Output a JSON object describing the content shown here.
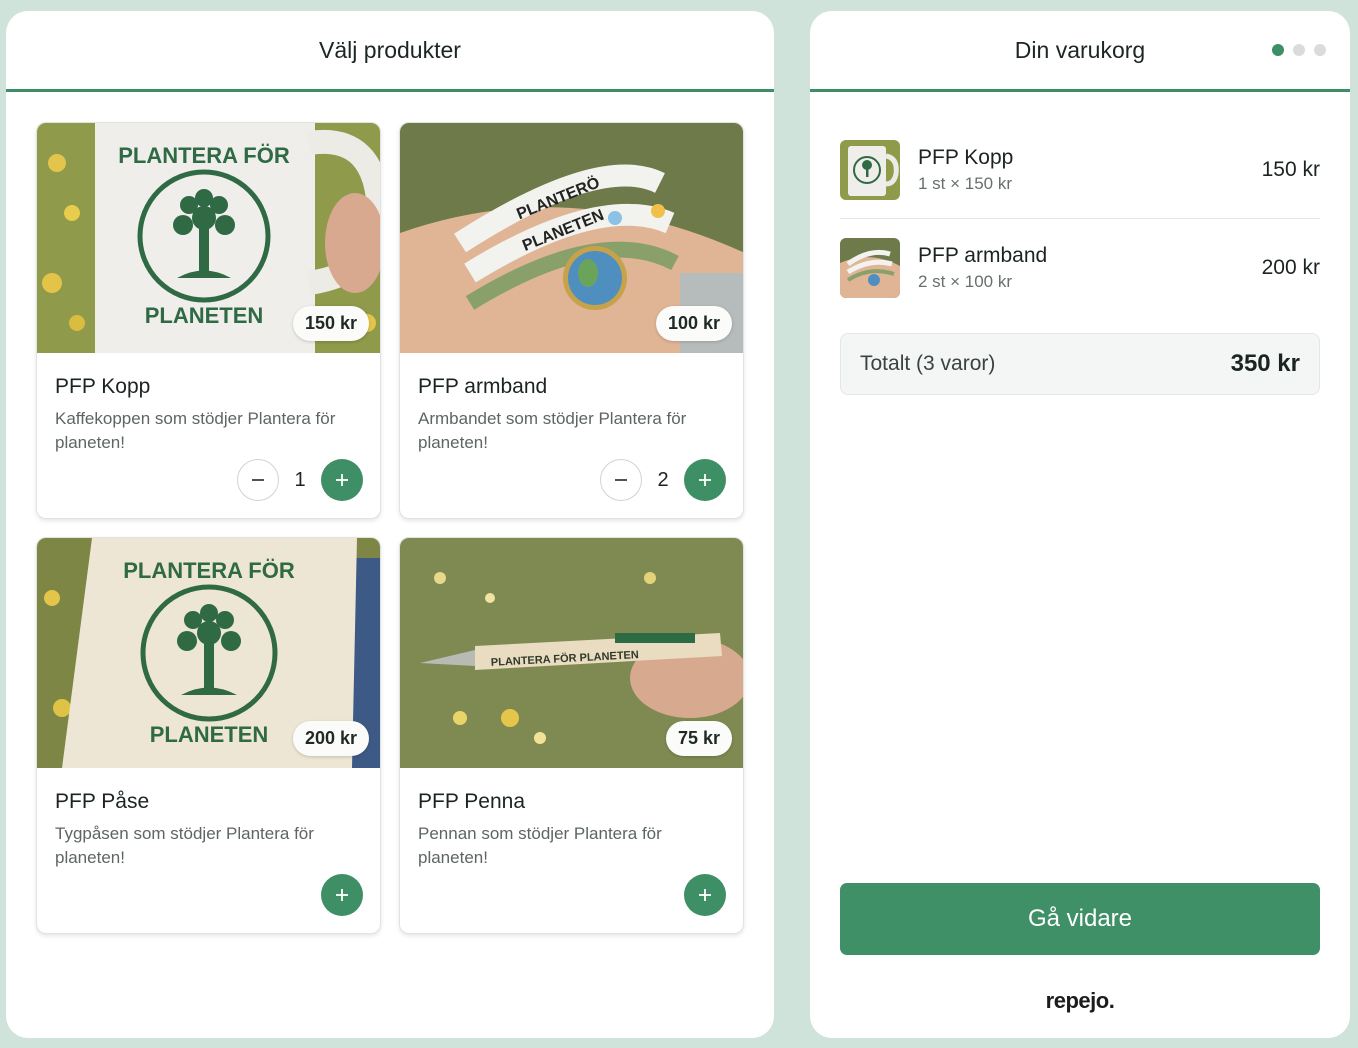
{
  "products_panel": {
    "title": "Välj produkter",
    "products": [
      {
        "name": "PFP Kopp",
        "description": "Kaffekoppen som stödjer Plantera för planeten!",
        "price": "150 kr",
        "quantity": "1"
      },
      {
        "name": "PFP armband",
        "description": "Armbandet som stödjer Plantera för planeten!",
        "price": "100 kr",
        "quantity": "2"
      },
      {
        "name": "PFP Påse",
        "description": "Tygpåsen som stödjer Plantera för planeten!",
        "price": "200 kr",
        "quantity": "0"
      },
      {
        "name": "PFP Penna",
        "description": "Pennan som stödjer Plantera för planeten!",
        "price": "75 kr",
        "quantity": "0"
      }
    ],
    "logo_text": {
      "top": "PLANTERA FÖR",
      "bottom": "PLANETEN",
      "bracelet_1": "PLANTERÖ",
      "bracelet_2": "PLANETEN",
      "pen": "PLANTERA FÖR PLANETEN"
    }
  },
  "cart_panel": {
    "title": "Din varukorg",
    "step_indicator": {
      "total_steps": 3,
      "active_step": 1
    },
    "items": [
      {
        "name": "PFP Kopp",
        "detail": "1 st × 150 kr",
        "price": "150 kr"
      },
      {
        "name": "PFP armband",
        "detail": "2 st × 100 kr",
        "price": "200 kr"
      }
    ],
    "total_label": "Totalt (3 varor)",
    "total_value": "350 kr",
    "proceed_label": "Gå vidare",
    "brand": "repejo."
  },
  "colors": {
    "accent": "#3e8e66",
    "background": "#cfe3da",
    "logo_green": "#2f6a45"
  },
  "icons": [
    "minus-icon",
    "plus-icon",
    "step-dot"
  ]
}
